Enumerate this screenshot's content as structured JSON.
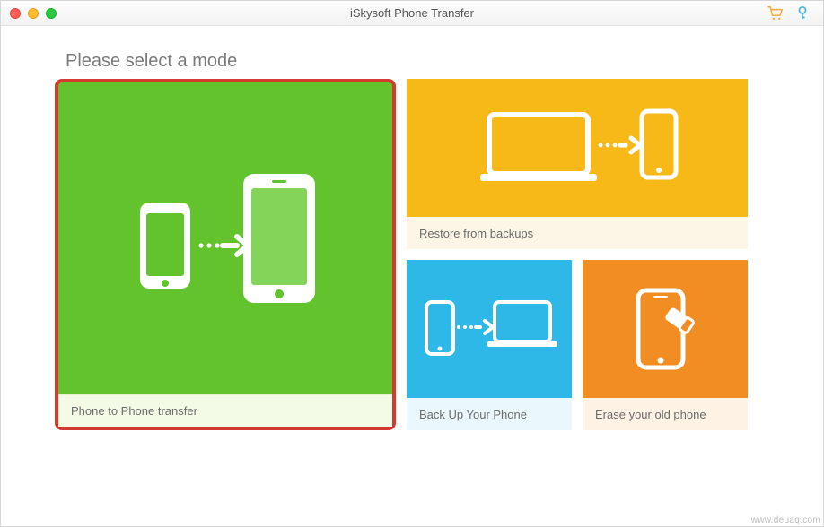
{
  "window": {
    "title": "iSkysoft Phone Transfer"
  },
  "heading": "Please select a mode",
  "cards": {
    "phone_to_phone": {
      "label": "Phone to Phone transfer"
    },
    "restore": {
      "label": "Restore from backups"
    },
    "backup": {
      "label": "Back Up Your Phone"
    },
    "erase": {
      "label": "Erase your old phone"
    }
  },
  "watermark": "www.deuaq.com",
  "colors": {
    "green": "#62c32d",
    "yellow": "#f7b917",
    "blue": "#2eb8e7",
    "orange": "#f18d22",
    "highlight_border": "#d43a2f"
  }
}
